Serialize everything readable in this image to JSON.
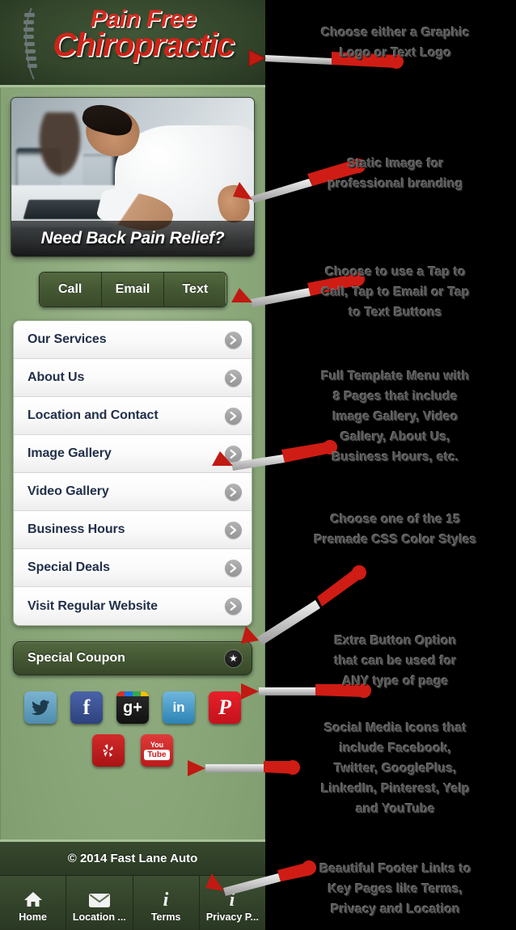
{
  "app": {
    "header": {
      "logo_line1": "Pain Free",
      "logo_line2": "Chiropractic",
      "spine_icon": "spine-icon"
    },
    "banner": {
      "caption": "Need Back Pain Relief?",
      "image_alt": "man-with-back-pain-at-desk"
    },
    "action_buttons": [
      {
        "label": "Call",
        "name": "call-button"
      },
      {
        "label": "Email",
        "name": "email-button"
      },
      {
        "label": "Text",
        "name": "text-button"
      }
    ],
    "menu": [
      {
        "label": "Our Services"
      },
      {
        "label": "About Us"
      },
      {
        "label": "Location and Contact"
      },
      {
        "label": "Image Gallery"
      },
      {
        "label": "Video Gallery"
      },
      {
        "label": "Business Hours"
      },
      {
        "label": "Special Deals"
      },
      {
        "label": "Visit Regular Website"
      }
    ],
    "coupon": {
      "label": "Special Coupon",
      "badge_icon": "star-icon",
      "badge_glyph": "★"
    },
    "social": {
      "row1": [
        {
          "name": "twitter-icon",
          "glyph": "🐦"
        },
        {
          "name": "facebook-icon",
          "glyph": "f"
        },
        {
          "name": "googleplus-icon",
          "glyph": "g+"
        },
        {
          "name": "linkedin-icon",
          "glyph": "in"
        },
        {
          "name": "pinterest-icon",
          "glyph": "P"
        }
      ],
      "row2": [
        {
          "name": "yelp-icon",
          "glyph": "✸"
        },
        {
          "name": "youtube-icon",
          "glyph": "You",
          "glyph2": "Tube"
        }
      ]
    },
    "footer": {
      "copyright": "© 2014 Fast Lane Auto",
      "tabs": [
        {
          "label": "Home",
          "icon": "home-icon"
        },
        {
          "label": "Location ...",
          "icon": "envelope-icon"
        },
        {
          "label": "Terms",
          "icon": "info-icon"
        },
        {
          "label": "Privacy P...",
          "icon": "info-icon"
        }
      ]
    }
  },
  "annotations": [
    {
      "id": "a1",
      "text": "Choose either a Graphic\nLogo or Text Logo"
    },
    {
      "id": "a2",
      "text": "Static Image for\nprofessional branding"
    },
    {
      "id": "a3",
      "text": "Choose to use a Tap to\nCall, Tap to Email or Tap\nto Text Buttons"
    },
    {
      "id": "a4",
      "text": "Full Template Menu with\n8 Pages that include\nImage Gallery, Video\nGallery, About Us,\nBusiness Hours, etc."
    },
    {
      "id": "a5",
      "text": "Choose one of the 15\nPremade CSS Color Styles"
    },
    {
      "id": "a6",
      "text": "Extra Button Option\nthat can be used for\nANY type of page"
    },
    {
      "id": "a7",
      "text": "Social Media Icons that\ninclude Facebook,\nTwitter, GooglePlus,\nLinkedIn, Pinterest, Yelp\nand YouTube"
    },
    {
      "id": "a8",
      "text": "Beautiful Footer Links to\nKey Pages like Terms,\nPrivacy and Location"
    }
  ],
  "colors": {
    "background": "#000000",
    "app_green": "#8aa77a",
    "header_dark_green": "#33452b",
    "logo_red": "#cf2318",
    "accent_arrow_red": "#c01a12",
    "menu_text_navy": "#22304a",
    "annotation_gray": "#555555"
  }
}
